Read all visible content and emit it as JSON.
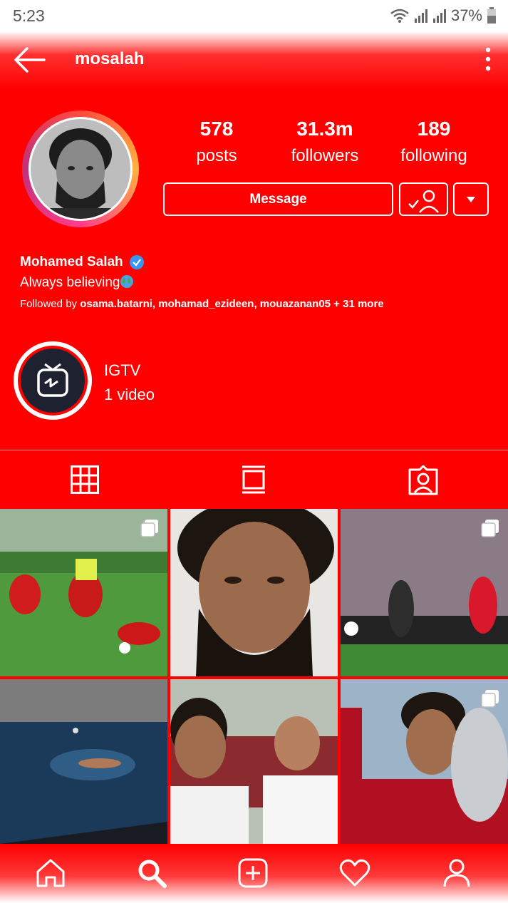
{
  "status_bar": {
    "time": "5:23",
    "battery": "37%"
  },
  "header": {
    "username": "mosalah"
  },
  "profile": {
    "stats": [
      {
        "value": "578",
        "label": "posts"
      },
      {
        "value": "31.3m",
        "label": "followers"
      },
      {
        "value": "189",
        "label": "following"
      }
    ],
    "message_label": "Message",
    "name": "Mohamed Salah",
    "bio": "Always believing",
    "followed_prefix": "Followed by ",
    "followed_names": "osama.batarni, mohamad_ezideen, mouazanan05",
    "followed_suffix": " + 31 more"
  },
  "highlight": {
    "title": "IGTV",
    "subtitle": "1 video"
  },
  "colors": {
    "theme": "#ff0000",
    "verified": "#3897f0"
  }
}
